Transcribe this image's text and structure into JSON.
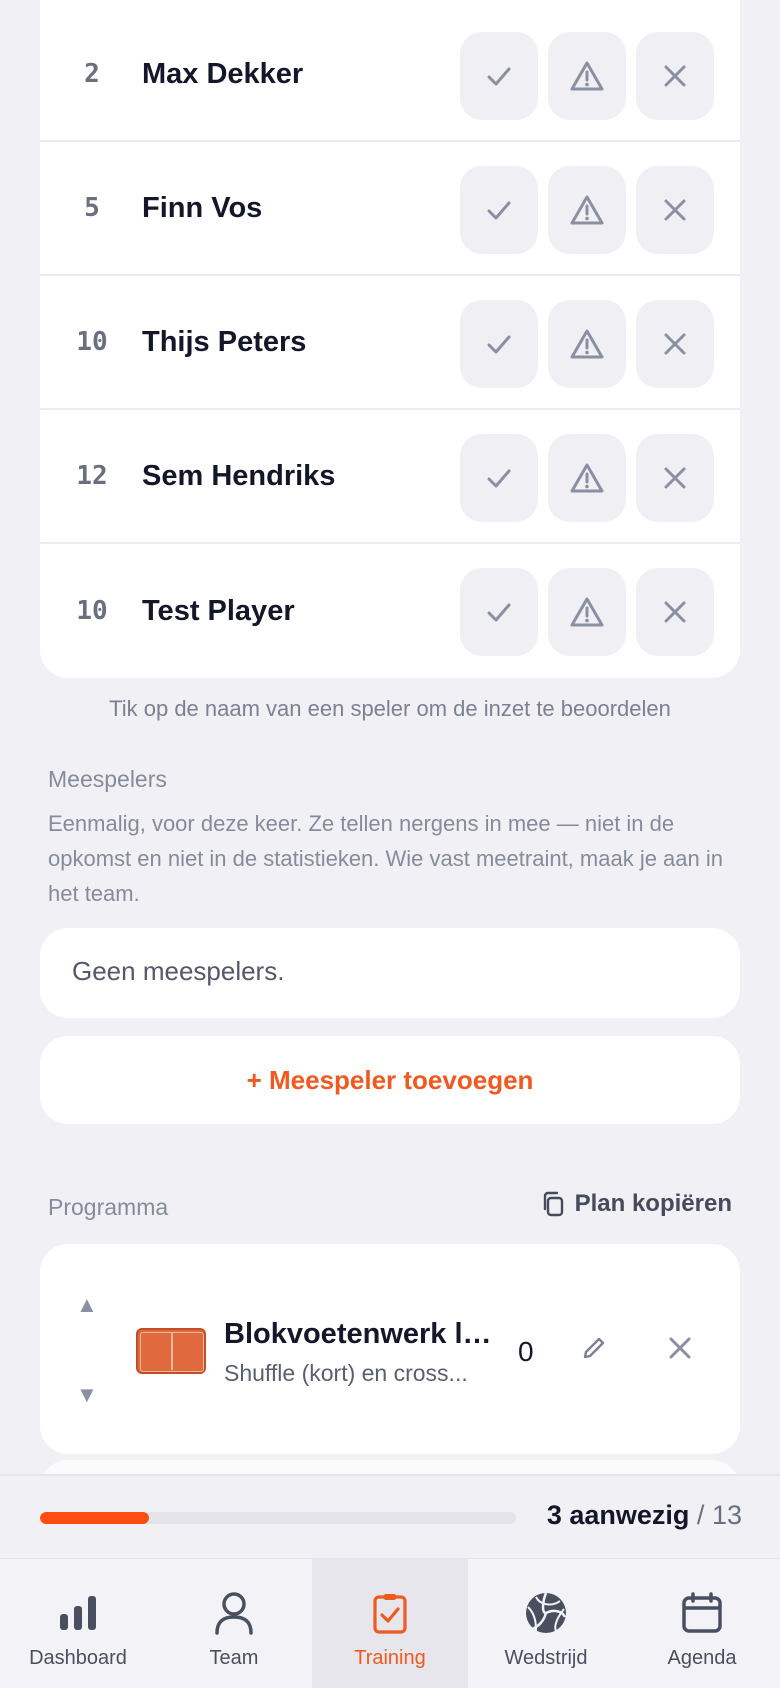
{
  "players": [
    {
      "number": "2",
      "name": "Max Dekker"
    },
    {
      "number": "5",
      "name": "Finn Vos"
    },
    {
      "number": "10",
      "name": "Thijs Peters"
    },
    {
      "number": "12",
      "name": "Sem Hendriks"
    },
    {
      "number": "10",
      "name": "Test Player"
    }
  ],
  "players_hint": "Tik op de naam van een speler om de inzet te beoordelen",
  "meespelers": {
    "label": "Meespelers",
    "description": "Eenmalig, voor deze keer. Ze tellen nergens in mee — niet in de opkomst en niet in de statistieken. Wie vast meetraint, maak je aan in het team.",
    "empty_text": "Geen meespelers.",
    "add_label": "+ Meespeler toevoegen"
  },
  "programma": {
    "label": "Programma",
    "copy_label": "Plan kopiëren",
    "exercises": [
      {
        "title": "Blokvoetenwerk la...",
        "subtitle": "Shuffle (kort) en cross...",
        "count": "0"
      }
    ]
  },
  "attendance": {
    "present_label": "3 aanwezig",
    "separator": "/",
    "total": "13",
    "fraction": 0.23
  },
  "nav": {
    "dashboard": "Dashboard",
    "team": "Team",
    "training": "Training",
    "wedstrijd": "Wedstrijd",
    "agenda": "Agenda"
  },
  "colors": {
    "accent": "#f0591f",
    "progress": "#ff4d12",
    "background": "#f1f1f5"
  },
  "icons": {
    "present": "check-icon",
    "injured": "warning-icon",
    "absent": "close-icon"
  }
}
